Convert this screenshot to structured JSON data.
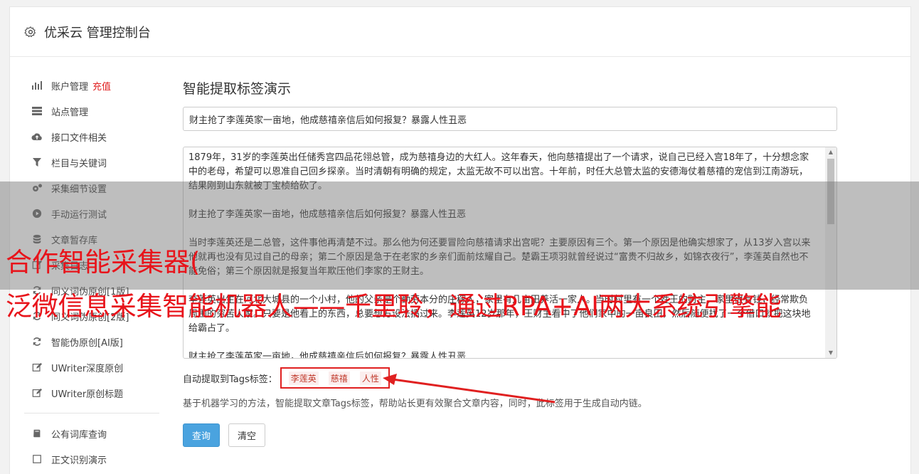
{
  "header": {
    "title": "优采云 管理控制台"
  },
  "sidebar": {
    "items": [
      {
        "label": "账户管理",
        "badge": "充值",
        "icon": "bar-chart-icon"
      },
      {
        "label": "站点管理",
        "icon": "server-icon"
      },
      {
        "label": "接口文件相关",
        "icon": "cloud-upload-icon"
      },
      {
        "label": "栏目与关键词",
        "icon": "filter-icon"
      },
      {
        "label": "采集细节设置",
        "icon": "gears-icon"
      },
      {
        "label": "手动运行测试",
        "icon": "play-circle-icon"
      },
      {
        "label": "文章暂存库",
        "icon": "database-icon"
      },
      {
        "label": "采集日志",
        "icon": "edit-icon"
      },
      {
        "label": "同义词伪原创[1版]",
        "icon": "refresh-icon"
      },
      {
        "label": "同义词伪原创[2版]",
        "icon": "refresh-icon"
      },
      {
        "label": "智能伪原创[AI版]",
        "icon": "refresh-icon"
      },
      {
        "label": "UWriter深度原创",
        "icon": "edit-icon"
      },
      {
        "label": "UWriter原创标题",
        "icon": "edit-icon"
      }
    ],
    "items2": [
      {
        "label": "公有词库查询",
        "icon": "book-icon"
      },
      {
        "label": "正文识别演示",
        "icon": "square-icon"
      }
    ]
  },
  "main": {
    "heading": "智能提取标签演示",
    "title_value": "财主抢了李莲英家一亩地，他成慈禧亲信后如何报复？暴露人性丑恶",
    "paragraphs": [
      "1879年，31岁的李莲英出任储秀宫四品花翎总管，成为慈禧身边的大红人。这年春天，他向慈禧提出了一个请求，说自己已经入宫18年了，十分想念家中的老母，希望可以恩准自己回乡探亲。当时清朝有明确的规定，太监无故不可以出宫。十年前，时任大总管太监的安德海仗着慈禧的宠信到江南游玩，结果刚到山东就被丁宝桢给砍了。",
      "财主抢了李莲英家一亩地，他成慈禧亲信后如何报复？暴露人性丑恶",
      "当时李莲英还是二总管，这件事他再清楚不过。那么他为何还要冒险向慈禧请求出宫呢？主要原因有三个。第一个原因是他确实想家了，从13岁入宫以来他就再也没有见过自己的母亲；第二个原因是急于在老家的乡亲们面前炫耀自己。楚霸王项羽就曾经说过“富贵不归故乡，如锦衣夜行”，李莲英自然也不能免俗；第三个原因就是报复当年欺压他们李家的王财主。",
      "李莲英出生在河北大城县的一个小村，他的父亲是个勤劳本分的庄稼人，家里有几亩田养活一家人。当时村里有一个姓王的财主，家里很有钱，经常欺负周围的穷苦人家。只要是他看上的东西，总要想方设法搞过来。李莲英12岁那年，王财主看中了他们家中的一亩良田，然后随便找了一个借口就把这块地给霸占了。",
      "财主抢了李莲英家一亩地，他成慈禧亲信后如何报复？暴露人性丑恶"
    ],
    "tags_label": "自动提取到Tags标签：",
    "tags": [
      "李莲英",
      "慈禧",
      "人性"
    ],
    "description": "基于机器学习的方法，智能提取文章Tags标签，帮助站长更有效聚合文章内容，同时，此标签用于生成自动内链。",
    "query_button": "查询",
    "clear_button": "清空"
  },
  "overlay": {
    "line1": "合作智能采集器(",
    "line2": "泛微信息采集智能机器人——千里聆，通过RPA+AI两大系统引擎能"
  },
  "colors": {
    "accent": "#4aa3df",
    "tag_red": "#e02020",
    "overlay_red": "#e8141b"
  }
}
